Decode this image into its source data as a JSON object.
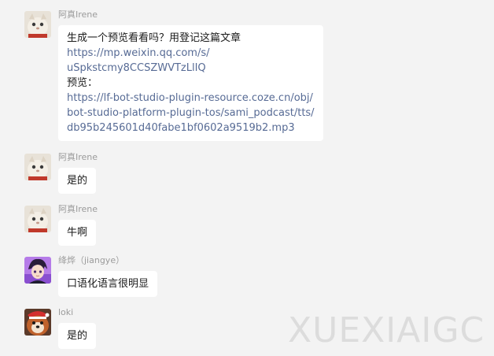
{
  "messages": [
    {
      "sender": "阿真Irene",
      "avatar_icon": "cat-avatar-icon",
      "lines": [
        {
          "text": "生成一个预览看看吗？用登记这篇文章",
          "link": false
        },
        {
          "text": "https://mp.weixin.qq.com/s/",
          "link": true
        },
        {
          "text": "uSpkstcmy8CCSZWVTzLlIQ",
          "link": true
        },
        {
          "text": "预览：",
          "link": false
        },
        {
          "text": "https://lf-bot-studio-plugin-resource.coze.cn/obj/",
          "link": true
        },
        {
          "text": "bot-studio-platform-plugin-tos/sami_podcast/tts/",
          "link": true
        },
        {
          "text": "db95b245601d40fabe1bf0602a9519b2.mp3",
          "link": true
        }
      ]
    },
    {
      "sender": "阿真Irene",
      "avatar_icon": "cat-avatar-icon",
      "lines": [
        {
          "text": "是的",
          "link": false
        }
      ]
    },
    {
      "sender": "阿真Irene",
      "avatar_icon": "cat-avatar-icon",
      "lines": [
        {
          "text": "牛啊",
          "link": false
        }
      ]
    },
    {
      "sender": "绛烨（jiangye）",
      "avatar_icon": "anime-avatar-icon",
      "lines": [
        {
          "text": "口语化语言很明显",
          "link": false
        }
      ]
    },
    {
      "sender": "loki",
      "avatar_icon": "dog-avatar-icon",
      "lines": [
        {
          "text": "是的",
          "link": false
        }
      ]
    }
  ],
  "watermark": "XUEXIAIGC",
  "colors": {
    "background": "#f3f3f3",
    "bubble": "#ffffff",
    "link": "#576b95",
    "sender": "#9b9b9b"
  }
}
